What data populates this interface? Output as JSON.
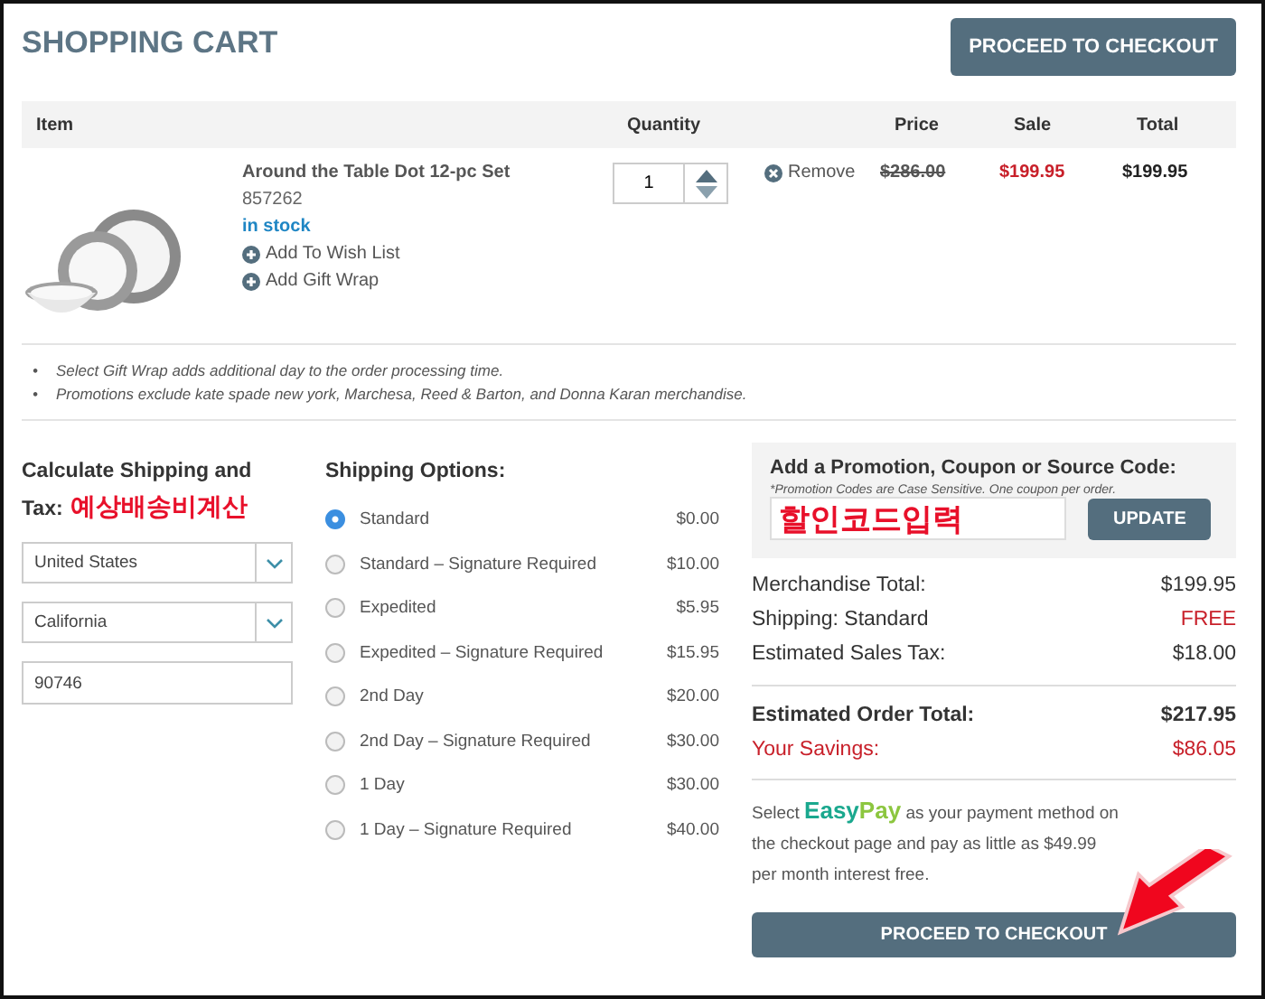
{
  "header": {
    "title": "SHOPPING CART",
    "checkout_button": "PROCEED TO CHECKOUT"
  },
  "table": {
    "columns": [
      "Item",
      "Quantity",
      "Price",
      "Sale",
      "Total"
    ],
    "rows": [
      {
        "name": "Around the Table Dot 12-pc Set",
        "sku": "857262",
        "stock": "in stock",
        "wish": "Add To Wish List",
        "gift": "Add Gift Wrap",
        "quantity": "1",
        "remove": "Remove",
        "price": "$286.00",
        "sale": "$199.95",
        "total": "$199.95"
      }
    ]
  },
  "notes": [
    {
      "bullet": "•",
      "text": "Select Gift Wrap adds additional day to the order processing time."
    },
    {
      "bullet": "•",
      "text": "Promotions exclude kate spade new york, Marchesa, Reed & Barton, and Donna Karan merchandise."
    }
  ],
  "shipping_calc": {
    "title": "Calculate Shipping and Tax:",
    "annotation": "예상배송비계산",
    "country": "United States",
    "state": "California",
    "zip": "90746"
  },
  "shipping_options": {
    "title": "Shipping Options:",
    "options": [
      {
        "label": "Standard",
        "price": "$0.00",
        "selected": true
      },
      {
        "label": "Standard – Signature Required",
        "price": "$10.00",
        "selected": false
      },
      {
        "label": "Expedited",
        "price": "$5.95",
        "selected": false
      },
      {
        "label": "Expedited – Signature Required",
        "price": "$15.95",
        "selected": false
      },
      {
        "label": "2nd Day",
        "price": "$20.00",
        "selected": false
      },
      {
        "label": "2nd Day – Signature Required",
        "price": "$30.00",
        "selected": false
      },
      {
        "label": "1 Day",
        "price": "$30.00",
        "selected": false
      },
      {
        "label": "1 Day – Signature Required",
        "price": "$40.00",
        "selected": false
      }
    ]
  },
  "promo": {
    "title": "Add a Promotion, Coupon or Source Code:",
    "hint": "*Promotion Codes are Case Sensitive. One coupon per order.",
    "code": "할인코드입력",
    "button": "UPDATE"
  },
  "summary": {
    "lines": [
      {
        "label": "Merchandise Total:",
        "value": "$199.95",
        "alert": false
      },
      {
        "label": "Shipping: Standard",
        "value": "FREE",
        "alert": true
      },
      {
        "label": "Estimated Sales Tax:",
        "value": "$18.00",
        "alert": false
      }
    ],
    "totals": [
      {
        "label": "Estimated Order Total:",
        "value": "$217.95",
        "alert": false
      },
      {
        "label": "Your Savings:",
        "value": "$86.05",
        "alert": true
      }
    ]
  },
  "easypay": {
    "before": "Select",
    "brand_a": "Easy",
    "brand_b": "Pay",
    "after": "as your payment method on the checkout page and pay as little as $49.99 per month interest free."
  },
  "checkout_button": "PROCEED TO CHECKOUT"
}
